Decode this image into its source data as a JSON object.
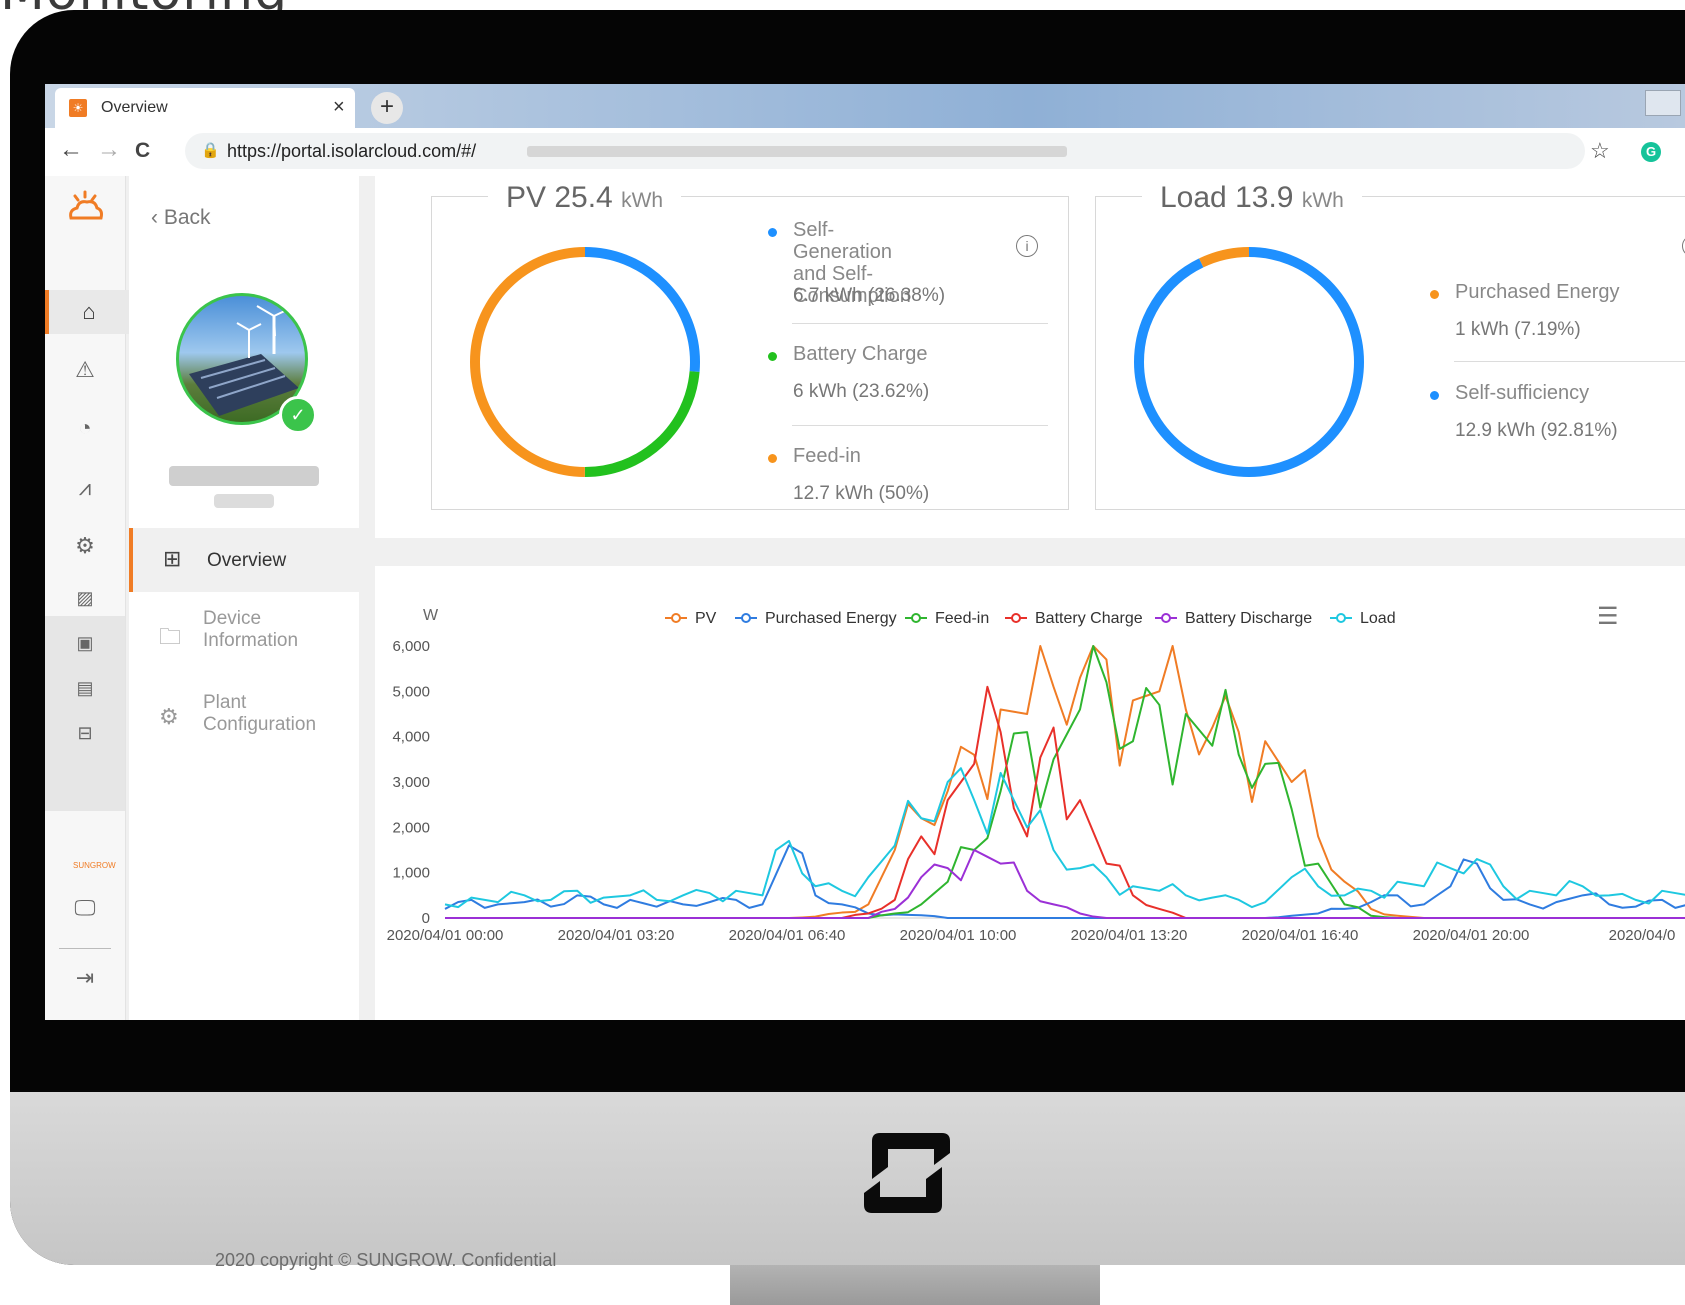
{
  "slide": {
    "title": "Monitoring",
    "copyright": "2020 copyright © SUNGROW. Confidential"
  },
  "browser": {
    "tab_title": "Overview",
    "tab_close": "×",
    "new_tab": "+",
    "url": "https://portal.isolarcloud.com/#/",
    "back_icon": "←",
    "forward_icon": "→",
    "reload_icon": "C",
    "star_icon": "☆",
    "ext_icon": "G"
  },
  "sidenav": {
    "back_label": "Back",
    "items": [
      {
        "label": "Overview",
        "icon": "grid-icon"
      },
      {
        "label": "Device\nInformation",
        "icon": "folder-icon"
      },
      {
        "label": "Plant\nConfiguration",
        "icon": "gear-icon"
      }
    ]
  },
  "pv_card": {
    "title": "PV 25.4",
    "unit": "kWh",
    "items": [
      {
        "label": "Self-Generation and Self-\nConsumption",
        "value": "6.7 kWh (26.38%)",
        "color": "#1e90ff",
        "fraction": 0.2638
      },
      {
        "label": "Battery Charge",
        "value": "6 kWh (23.62%)",
        "color": "#22c11e",
        "fraction": 0.2362
      },
      {
        "label": "Feed-in",
        "value": "12.7 kWh (50%)",
        "color": "#f7941d",
        "fraction": 0.5
      }
    ]
  },
  "load_card": {
    "title": "Load 13.9",
    "unit": "kWh",
    "items": [
      {
        "label": "Purchased Energy",
        "value": "1 kWh (7.19%)",
        "color": "#f7941d",
        "fraction": 0.0719
      },
      {
        "label": "Self-sufficiency",
        "value": "12.9 kWh (92.81%)",
        "color": "#1e90ff",
        "fraction": 0.9281
      }
    ]
  },
  "chart_data": {
    "type": "line",
    "ylabel": "W",
    "ylim": [
      0,
      6000
    ],
    "y_ticks": [
      "0",
      "1,000",
      "2,000",
      "3,000",
      "4,000",
      "5,000",
      "6,000"
    ],
    "x_ticks": [
      "2020/04/01 00:00",
      "2020/04/01 03:20",
      "2020/04/01 06:40",
      "2020/04/01 10:00",
      "2020/04/01 13:20",
      "2020/04/01 16:40",
      "2020/04/01 20:00",
      "2020/04/0"
    ],
    "x_hours": [
      0,
      0.5,
      1,
      1.5,
      2,
      2.5,
      3,
      3.5,
      4,
      4.5,
      5,
      5.5,
      6,
      6.5,
      7,
      7.5,
      8,
      8.5,
      9,
      9.5,
      10,
      10.5,
      11,
      11.5,
      12,
      12.5,
      13,
      13.5,
      14,
      14.5,
      15,
      15.5,
      16,
      16.5,
      17,
      17.5,
      18,
      18.5,
      19,
      19.5,
      20,
      20.5,
      21,
      21.5,
      22,
      22.5,
      23,
      23.5,
      24
    ],
    "legend_position": "top",
    "series": [
      {
        "name": "PV",
        "color": "#f07c25",
        "values": [
          0,
          0,
          0,
          0,
          0,
          0,
          0,
          0,
          0,
          0,
          0,
          0,
          0,
          0,
          30,
          120,
          300,
          1500,
          2200,
          2800,
          3600,
          4600,
          4500,
          5100,
          5300,
          5700,
          4800,
          5000,
          4600,
          4200,
          4100,
          3900,
          3000,
          1800,
          800,
          200,
          50,
          0,
          0,
          0,
          0,
          0,
          0,
          0,
          0,
          0,
          0,
          0,
          0
        ]
      },
      {
        "name": "Purchased Energy",
        "color": "#2f7ce0",
        "values": [
          200,
          400,
          300,
          350,
          250,
          500,
          300,
          400,
          250,
          300,
          350,
          400,
          300,
          1600,
          500,
          300,
          100,
          80,
          60,
          0,
          0,
          0,
          0,
          0,
          0,
          0,
          0,
          0,
          0,
          0,
          0,
          0,
          50,
          100,
          200,
          350,
          500,
          300,
          700,
          1200,
          400,
          300,
          350,
          500,
          300,
          250,
          400,
          300,
          350
        ]
      },
      {
        "name": "Feed-in",
        "color": "#2fb52f",
        "values": [
          0,
          0,
          0,
          0,
          0,
          0,
          0,
          0,
          0,
          0,
          0,
          0,
          0,
          0,
          0,
          0,
          0,
          100,
          300,
          800,
          1500,
          2800,
          4100,
          3500,
          4600,
          5200,
          3900,
          4700,
          4500,
          3800,
          3600,
          3400,
          2400,
          1200,
          300,
          50,
          0,
          0,
          0,
          0,
          0,
          0,
          0,
          0,
          0,
          0,
          0,
          0,
          0
        ]
      },
      {
        "name": "Battery Charge",
        "color": "#e8302a",
        "values": [
          0,
          0,
          0,
          0,
          0,
          0,
          0,
          0,
          0,
          0,
          0,
          0,
          0,
          0,
          0,
          0,
          100,
          400,
          1800,
          2600,
          3400,
          4100,
          1800,
          4200,
          2600,
          1200,
          500,
          200,
          0,
          0,
          0,
          0,
          0,
          0,
          0,
          0,
          0,
          0,
          0,
          0,
          0,
          0,
          0,
          0,
          0,
          0,
          0,
          0,
          0
        ]
      },
      {
        "name": "Battery Discharge",
        "color": "#9b30d6",
        "values": [
          0,
          0,
          0,
          0,
          0,
          0,
          0,
          0,
          0,
          0,
          0,
          0,
          0,
          0,
          0,
          0,
          0,
          200,
          900,
          1100,
          1500,
          1200,
          600,
          300,
          100,
          0,
          0,
          0,
          0,
          0,
          0,
          0,
          0,
          0,
          0,
          0,
          0,
          0,
          0,
          0,
          0,
          0,
          0,
          0,
          0,
          0,
          0,
          0,
          0
        ]
      },
      {
        "name": "Load",
        "color": "#1ec8e0",
        "values": [
          300,
          450,
          350,
          500,
          400,
          600,
          450,
          500,
          400,
          500,
          550,
          600,
          500,
          1700,
          700,
          600,
          900,
          1600,
          2200,
          3000,
          2600,
          3200,
          2000,
          1500,
          1100,
          900,
          700,
          600,
          500,
          450,
          400,
          350,
          900,
          700,
          500,
          600,
          800,
          700,
          1100,
          1300,
          700,
          600,
          500,
          700,
          500,
          400,
          600,
          500,
          450
        ]
      }
    ]
  },
  "chart_menu_icon": "☰"
}
